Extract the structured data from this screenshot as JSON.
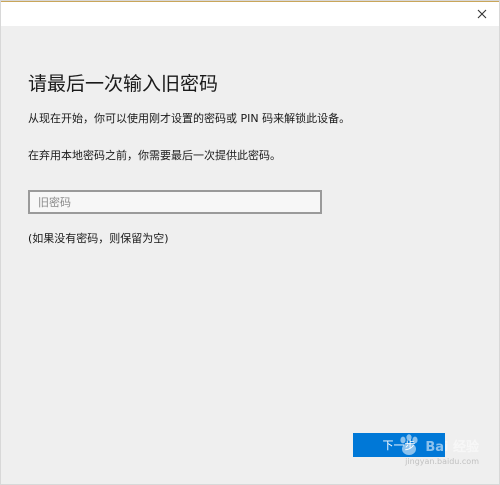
{
  "window": {
    "close_icon": "close-icon"
  },
  "dialog": {
    "title": "请最后一次输入旧密码",
    "description_1": "从现在开始，你可以使用刚才设置的密码或 PIN 码来解锁此设备。",
    "description_2": "在弃用本地密码之前，你需要最后一次提供此密码。",
    "password_input": {
      "value": "",
      "placeholder": "旧密码"
    },
    "hint": "(如果没有密码，则保留为空)",
    "next_button_label": "下一步"
  },
  "watermark": {
    "name": "Bai 经验",
    "domain": "jingyan.baidu.com"
  },
  "colors": {
    "accent": "#0078d7",
    "background": "#efefef",
    "titlebar": "#ffffff"
  }
}
